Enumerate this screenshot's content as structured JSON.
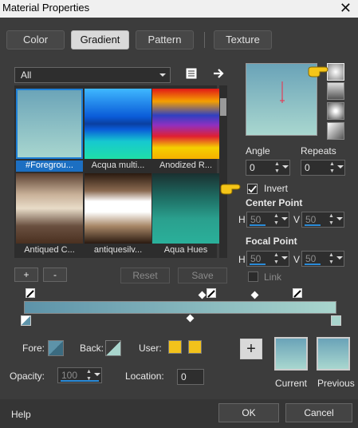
{
  "window": {
    "title": "Material Properties",
    "close": "✕"
  },
  "tabs": [
    "Color",
    "Gradient",
    "Pattern",
    "Texture"
  ],
  "category": {
    "selected": "All"
  },
  "gradients": [
    {
      "label": "#Foregrou...",
      "selected": true
    },
    {
      "label": "Acqua multi...",
      "selected": false
    },
    {
      "label": "Anodized R...",
      "selected": false
    },
    {
      "label": "Antiqued C...",
      "selected": false
    },
    {
      "label": "antiquesilv...",
      "selected": false
    },
    {
      "label": "Aqua Hues",
      "selected": false
    }
  ],
  "buttons": {
    "add": "+",
    "remove": "-",
    "reset": "Reset",
    "save": "Save",
    "help": "Help",
    "ok": "OK",
    "cancel": "Cancel",
    "add_color": "+"
  },
  "angle": {
    "label": "Angle",
    "value": "0"
  },
  "repeats": {
    "label": "Repeats",
    "value": "0"
  },
  "invert": {
    "label": "Invert",
    "checked": true
  },
  "center_point": {
    "label": "Center Point",
    "h_label": "H",
    "h": "50",
    "v_label": "V",
    "v": "50"
  },
  "focal_point": {
    "label": "Focal Point",
    "h_label": "H",
    "h": "50",
    "v_label": "V",
    "v": "50"
  },
  "link": {
    "label": "Link"
  },
  "bottom": {
    "fore_label": "Fore:",
    "back_label": "Back:",
    "user_label": "User:",
    "opacity_label": "Opacity:",
    "opacity_value": "100",
    "location_label": "Location:",
    "location_value": "0",
    "current_label": "Current",
    "previous_label": "Previous"
  },
  "colors": {
    "start": "#5d93a9",
    "end": "#a9d5cd",
    "user": "#f2c21b",
    "selection": "#1e7fd6"
  }
}
